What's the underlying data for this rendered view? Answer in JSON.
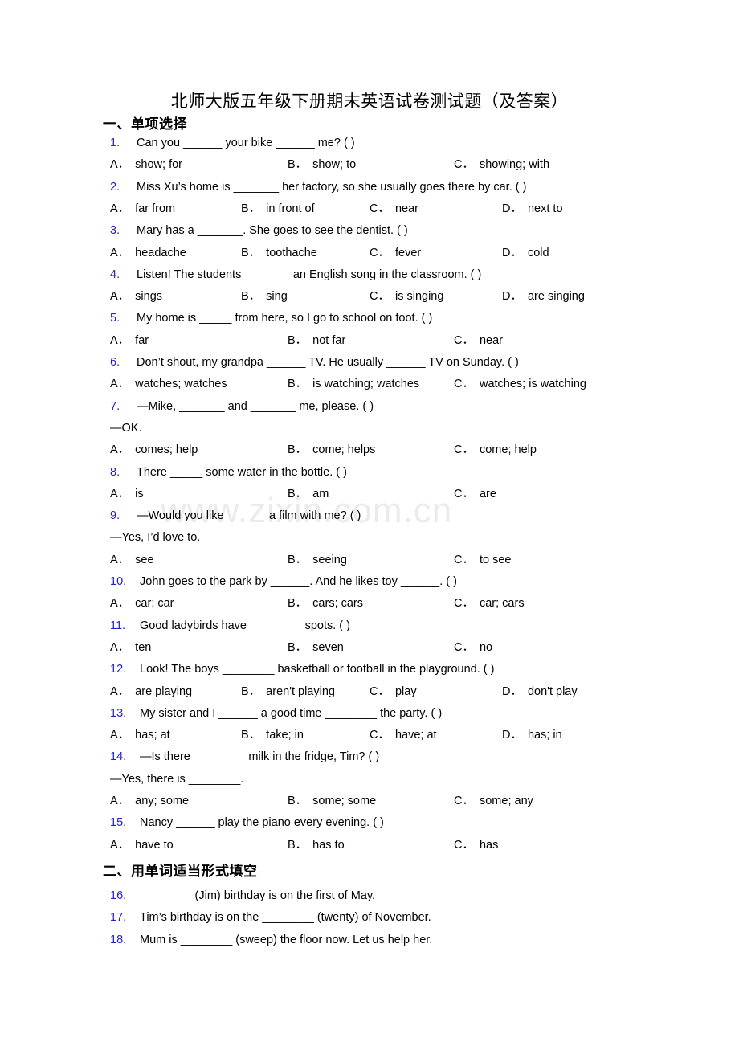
{
  "document": {
    "title": "北师大版五年级下册期末英语试卷测试题（及答案）",
    "watermark": "www.zixin.com.cn",
    "number_color": "#2222cc"
  },
  "sections": [
    {
      "id": "section-1",
      "heading": "一、单项选择"
    },
    {
      "id": "section-2",
      "heading": "二、用单词适当形式填空"
    }
  ],
  "questions": [
    {
      "num": "1.",
      "text": "Can you ______ your bike ______ me? (   )",
      "options": [
        {
          "label": "A．",
          "text": "show; for"
        },
        {
          "label": "B．",
          "text": "show; to"
        },
        {
          "label": "C．",
          "text": "showing; with"
        }
      ]
    },
    {
      "num": "2.",
      "text": "Miss Xu’s home is _______ her factory, so she usually goes there by car. (  )",
      "options": [
        {
          "label": "A．",
          "text": "far from"
        },
        {
          "label": "B．",
          "text": "in front of"
        },
        {
          "label": "C．",
          "text": "near"
        },
        {
          "label": "D．",
          "text": "next to"
        }
      ]
    },
    {
      "num": "3.",
      "text": "Mary has a _______. She goes to see the dentist. (  )",
      "options": [
        {
          "label": "A．",
          "text": "headache"
        },
        {
          "label": "B．",
          "text": "toothache"
        },
        {
          "label": "C．",
          "text": "fever"
        },
        {
          "label": "D．",
          "text": "cold"
        }
      ]
    },
    {
      "num": "4.",
      "text": "Listen! The students _______ an English song in the classroom. (  )",
      "options": [
        {
          "label": "A．",
          "text": "sings"
        },
        {
          "label": "B．",
          "text": "sing"
        },
        {
          "label": "C．",
          "text": "is singing"
        },
        {
          "label": "D．",
          "text": "are singing"
        }
      ]
    },
    {
      "num": "5.",
      "text": "My home is _____ from here, so I go to school on foot. (   )",
      "options": [
        {
          "label": "A．",
          "text": "far"
        },
        {
          "label": "B．",
          "text": "not far"
        },
        {
          "label": "C．",
          "text": "near"
        }
      ]
    },
    {
      "num": "6.",
      "text": "Don’t shout, my grandpa ______ TV. He usually ______ TV on Sunday. (  )",
      "options": [
        {
          "label": "A．",
          "text": "watches; watches"
        },
        {
          "label": "B．",
          "text": "is watching; watches"
        },
        {
          "label": "C．",
          "text": "watches; is watching"
        }
      ]
    },
    {
      "num": "7.",
      "text": "—Mike, _______ and _______ me, please. (   )",
      "continuation": "—OK.",
      "options": [
        {
          "label": "A．",
          "text": "comes; help"
        },
        {
          "label": "B．",
          "text": "come; helps"
        },
        {
          "label": "C．",
          "text": "come; help"
        }
      ]
    },
    {
      "num": "8.",
      "text": "There _____ some water in the bottle. (   )",
      "options": [
        {
          "label": "A．",
          "text": "is"
        },
        {
          "label": "B．",
          "text": "am"
        },
        {
          "label": "C．",
          "text": "are"
        }
      ]
    },
    {
      "num": "9.",
      "text": "—Would you like ______ a film with me? (  )",
      "continuation": "—Yes, I’d love to.",
      "options": [
        {
          "label": "A．",
          "text": "see"
        },
        {
          "label": "B．",
          "text": "seeing"
        },
        {
          "label": "C．",
          "text": "to see"
        }
      ]
    },
    {
      "num": "10.",
      "text": "John goes to the park by ______. And he likes toy ______. (  )",
      "options": [
        {
          "label": "A．",
          "text": "car; car"
        },
        {
          "label": "B．",
          "text": "cars; cars"
        },
        {
          "label": "C．",
          "text": "car; cars"
        }
      ]
    },
    {
      "num": "11.",
      "text": "Good ladybirds have ________ spots. (  )",
      "options": [
        {
          "label": "A．",
          "text": "ten"
        },
        {
          "label": "B．",
          "text": "seven"
        },
        {
          "label": "C．",
          "text": "no"
        }
      ]
    },
    {
      "num": "12.",
      "text": "Look! The boys ________ basketball or football in the playground. (  )",
      "options": [
        {
          "label": "A．",
          "text": "are playing"
        },
        {
          "label": "B．",
          "text": "aren't playing"
        },
        {
          "label": "C．",
          "text": "play"
        },
        {
          "label": "D．",
          "text": "don't play"
        }
      ]
    },
    {
      "num": "13.",
      "text": "My sister and I ______ a good time ________ the party. (  )",
      "options": [
        {
          "label": "A．",
          "text": "has; at"
        },
        {
          "label": "B．",
          "text": "take; in"
        },
        {
          "label": "C．",
          "text": "have; at"
        },
        {
          "label": "D．",
          "text": "has; in"
        }
      ]
    },
    {
      "num": "14.",
      "text": "—Is there ________ milk in the fridge, Tim? (   )",
      "continuation": "—Yes, there is ________.",
      "options": [
        {
          "label": "A．",
          "text": "any; some"
        },
        {
          "label": "B．",
          "text": "some; some"
        },
        {
          "label": "C．",
          "text": "some; any"
        }
      ]
    },
    {
      "num": "15.",
      "text": "Nancy ______ play the piano every evening. (   )",
      "options": [
        {
          "label": "A．",
          "text": "have to"
        },
        {
          "label": "B．",
          "text": "has to"
        },
        {
          "label": "C．",
          "text": "has"
        }
      ]
    }
  ],
  "fill_questions": [
    {
      "num": "16.",
      "text": "________ (Jim) birthday is on the first of May."
    },
    {
      "num": "17.",
      "text": "Tim’s birthday is on the ________ (twenty) of November."
    },
    {
      "num": "18.",
      "text": "Mum is ________ (sweep) the floor now. Let us help her."
    }
  ]
}
